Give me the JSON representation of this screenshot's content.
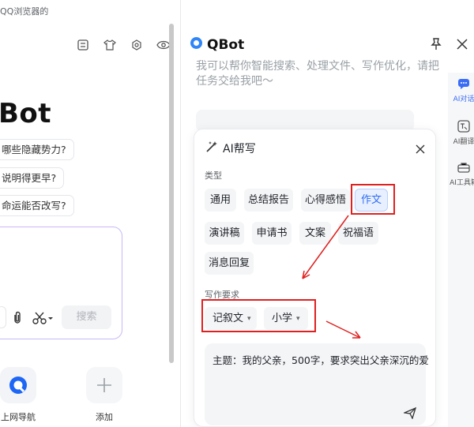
{
  "browser": {
    "title": "QQ浏览器的",
    "bot_word": "Bot",
    "questions": [
      "哪些隐藏势力?",
      "说明得更早?",
      "命运能否改写?"
    ],
    "search_label": "搜索",
    "shortcuts": [
      {
        "label": "上网导航",
        "icon": "qq-browser-logo-icon"
      },
      {
        "label": "添加",
        "icon": "plus-icon"
      }
    ]
  },
  "qbot": {
    "title": "QBot",
    "intro": "我可以帮你智能搜索、处理文件、写作优化，请把任务交给我吧～",
    "sidebar": [
      {
        "label": "AI对话",
        "icon": "chat-icon",
        "active": true
      },
      {
        "label": "AI翻译",
        "icon": "translate-icon",
        "active": false
      },
      {
        "label": "AI工具箱",
        "icon": "toolbox-icon",
        "active": false
      }
    ]
  },
  "writer": {
    "title": "AI帮写",
    "type_label": "类型",
    "types": [
      {
        "label": "通用",
        "selected": false
      },
      {
        "label": "总结报告",
        "selected": false
      },
      {
        "label": "心得感悟",
        "selected": false
      },
      {
        "label": "作文",
        "selected": true
      },
      {
        "label": "演讲稿",
        "selected": false
      },
      {
        "label": "申请书",
        "selected": false
      },
      {
        "label": "文案",
        "selected": false
      },
      {
        "label": "祝福语",
        "selected": false
      },
      {
        "label": "消息回复",
        "selected": false
      }
    ],
    "req_label": "写作要求",
    "style_value": "记叙文",
    "level_value": "小学",
    "prompt": "主题：我的父亲，500字，要求突出父亲深沉的爱"
  },
  "colors": {
    "accent": "#2f6bf2",
    "annotation": "#e02020",
    "input_border": "#c9b8f7"
  }
}
